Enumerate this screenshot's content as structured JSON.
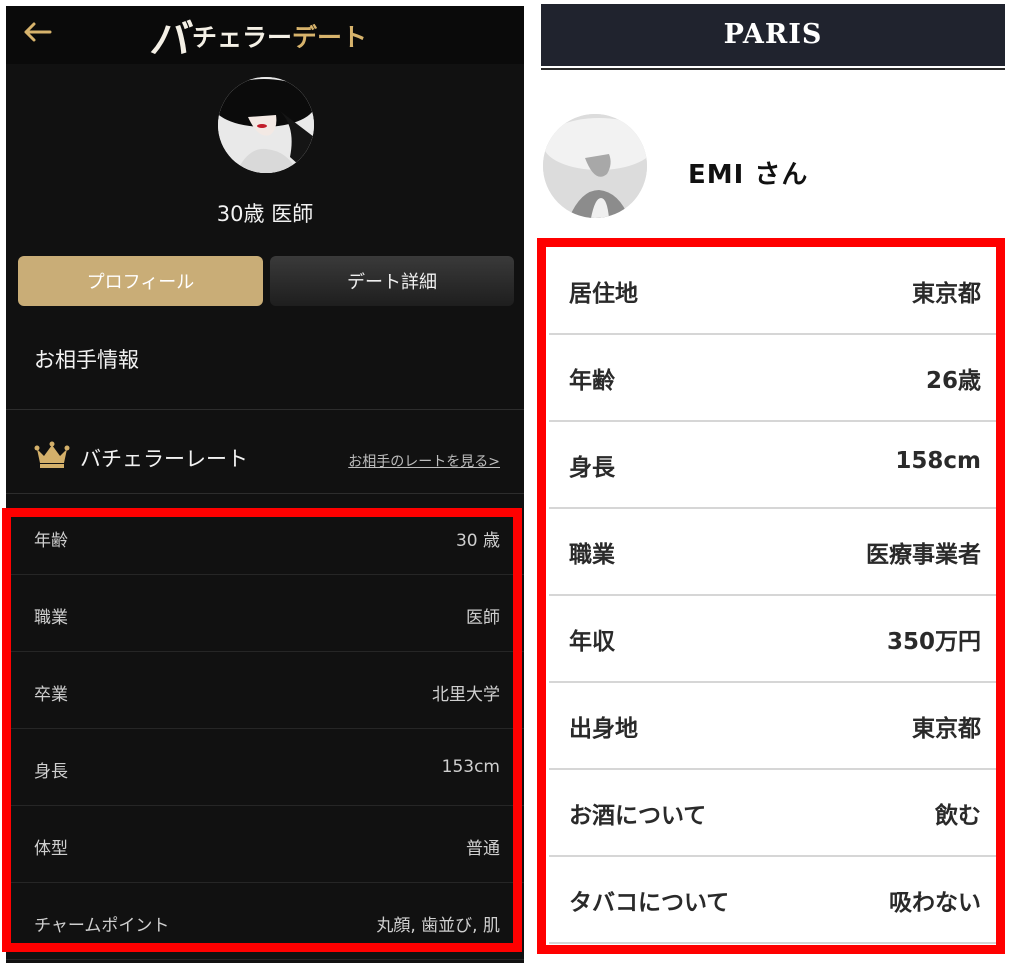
{
  "left_app": {
    "header": {
      "back_icon": "arrow-left-icon",
      "logo_parts": [
        "バ",
        "チェラー",
        "デート"
      ]
    },
    "profile": {
      "subtitle": "30歳 医師"
    },
    "tabs": [
      {
        "label": "プロフィール",
        "active": true
      },
      {
        "label": "デート詳細",
        "active": false
      }
    ],
    "section_title": "お相手情報",
    "rate": {
      "icon": "crown-icon",
      "label": "バチェラーレート",
      "link": "お相手のレートを見る>"
    },
    "info_rows": [
      {
        "label": "年齢",
        "value": "30 歳"
      },
      {
        "label": "職業",
        "value": "医師"
      },
      {
        "label": "卒業",
        "value": "北里大学"
      },
      {
        "label": "身長",
        "value": "153cm"
      },
      {
        "label": "体型",
        "value": "普通"
      },
      {
        "label": "チャームポイント",
        "value": "丸顔, 歯並び, 肌"
      }
    ],
    "colors": {
      "background": "#111111",
      "accent_gold": "#c9ad77",
      "highlight_red": "#ff0000"
    }
  },
  "right_app": {
    "header": {
      "title": "PARIS"
    },
    "profile": {
      "name": "EMI さん"
    },
    "info_rows": [
      {
        "label": "居住地",
        "value": "東京都"
      },
      {
        "label": "年齢",
        "value": "26歳"
      },
      {
        "label": "身長",
        "value": "158cm"
      },
      {
        "label": "職業",
        "value": "医療事業者"
      },
      {
        "label": "年収",
        "value": "350万円"
      },
      {
        "label": "出身地",
        "value": "東京都"
      },
      {
        "label": "お酒について",
        "value": "飲む"
      },
      {
        "label": "タバコについて",
        "value": "吸わない"
      }
    ],
    "colors": {
      "header_bg": "#20232e",
      "highlight_red": "#ff0000"
    }
  }
}
